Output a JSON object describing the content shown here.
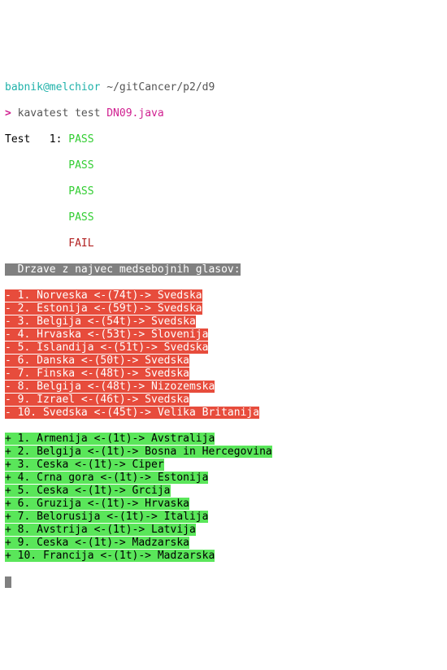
{
  "prompt": {
    "user": "babnik",
    "at": "@",
    "host": "melchior",
    "cwd": " ~/gitCancer/p2/d9",
    "symbol": ">",
    "command": "kavatest test ",
    "arg": "DN09.java"
  },
  "test": {
    "label": "Test   1: ",
    "indent": "          ",
    "results": [
      "PASS",
      "PASS",
      "PASS",
      "PASS",
      "FAIL"
    ]
  },
  "diff": {
    "header": "  Drzave z najvec medsebojnih glasov:",
    "minus": [
      "- 1. Norveska <-(74t)-> Svedska",
      "- 2. Estonija <-(59t)-> Svedska",
      "- 3. Belgija <-(54t)-> Svedska",
      "- 4. Hrvaska <-(53t)-> Slovenija",
      "- 5. Islandija <-(51t)-> Svedska",
      "- 6. Danska <-(50t)-> Svedska",
      "- 7. Finska <-(48t)-> Svedska",
      "- 8. Belgija <-(48t)-> Nizozemska",
      "- 9. Izrael <-(46t)-> Svedska",
      "- 10. Svedska <-(45t)-> Velika Britanija"
    ],
    "plus": [
      "+ 1. Armenija <-(1t)-> Avstralija",
      "+ 2. Belgija <-(1t)-> Bosna in Hercegovina",
      "+ 3. Ceska <-(1t)-> Ciper",
      "+ 4. Crna gora <-(1t)-> Estonija",
      "+ 5. Ceska <-(1t)-> Grcija",
      "+ 6. Gruzija <-(1t)-> Hrvaska",
      "+ 7. Belorusija <-(1t)-> Italija",
      "+ 8. Avstrija <-(1t)-> Latvija",
      "+ 9. Ceska <-(1t)-> Madzarska",
      "+ 10. Francija <-(1t)-> Madzarska"
    ]
  }
}
